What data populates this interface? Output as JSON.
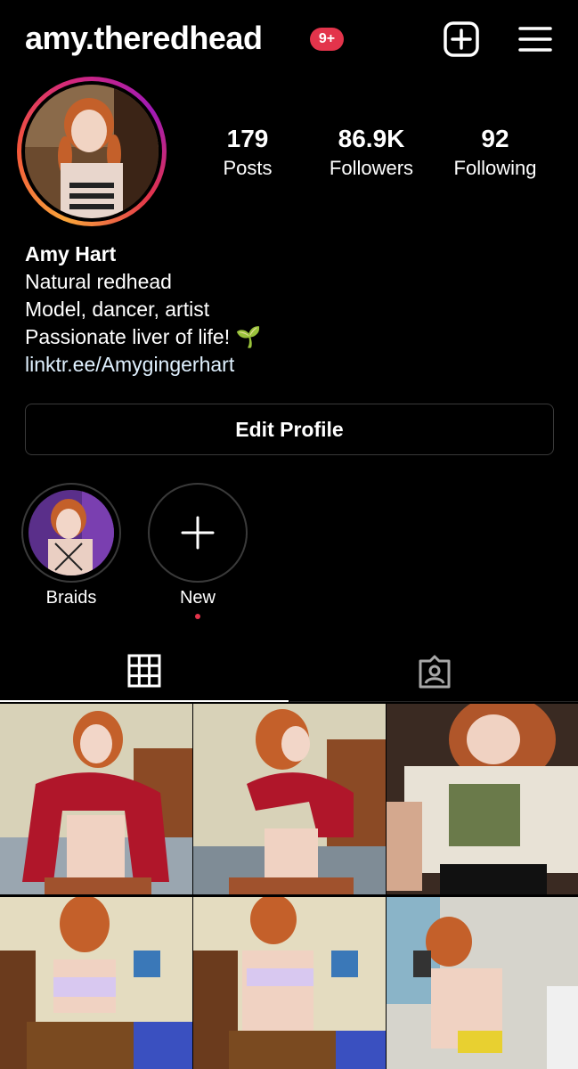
{
  "header": {
    "username": "amy.theredhead",
    "notification_badge": "9+",
    "add_icon": "plus-square-icon",
    "menu_icon": "hamburger-menu-icon"
  },
  "profile": {
    "avatar_alt": "profile picture"
  },
  "stats": {
    "posts": {
      "value": "179",
      "label": "Posts"
    },
    "followers": {
      "value": "86.9K",
      "label": "Followers"
    },
    "following": {
      "value": "92",
      "label": "Following"
    }
  },
  "bio": {
    "name": "Amy Hart",
    "lines": [
      "Natural redhead",
      "Model, dancer, artist",
      "Passionate liver of life! 🌱"
    ],
    "link": "linktr.ee/Amygingerhart"
  },
  "edit_button": "Edit Profile",
  "highlights": [
    {
      "label": "Braids"
    },
    {
      "label": "New"
    }
  ],
  "tabs": {
    "grid_icon": "grid-icon",
    "tagged_icon": "tagged-person-icon",
    "active": "grid"
  },
  "colors": {
    "background": "#000000",
    "badge": "#e3344b",
    "link": "#e0f1ff",
    "border": "#3a3a3a"
  }
}
